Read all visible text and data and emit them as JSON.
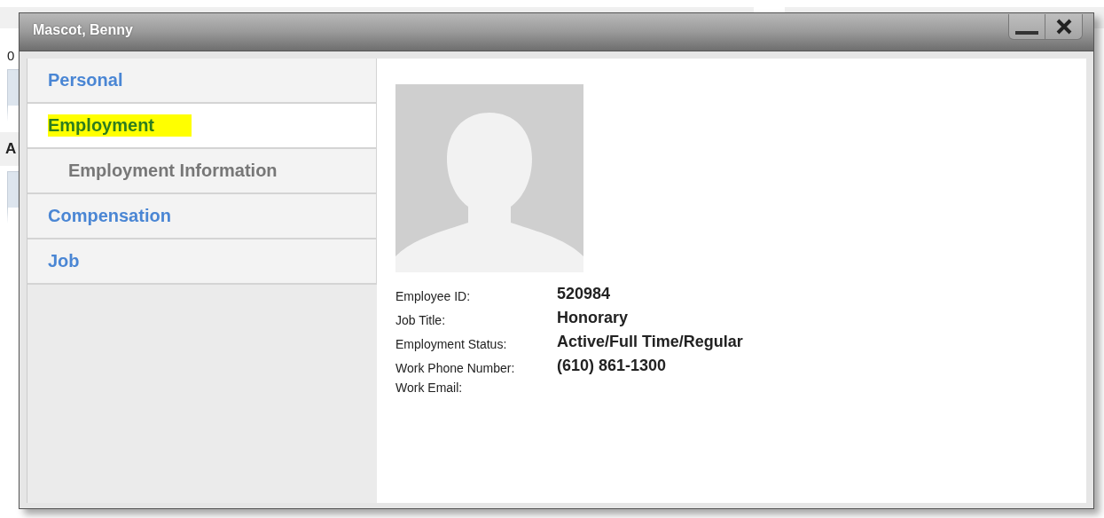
{
  "background": {
    "texts": [
      "0",
      "A"
    ]
  },
  "dialog": {
    "title": "Mascot, Benny",
    "nav": [
      {
        "label": "Personal",
        "kind": "section",
        "selected": false
      },
      {
        "label": "Employment",
        "kind": "section",
        "selected": true
      },
      {
        "label": "Employment Information",
        "kind": "subsection",
        "selected": false
      },
      {
        "label": "Compensation",
        "kind": "section",
        "selected": false
      },
      {
        "label": "Job",
        "kind": "section",
        "selected": false
      }
    ],
    "details": [
      {
        "label": "Employee ID:",
        "value": "520984"
      },
      {
        "label": "Job Title:",
        "value": "Honorary"
      },
      {
        "label": "Employment Status:",
        "value": "Active/Full Time/Regular"
      },
      {
        "label": "Work Phone Number:",
        "value": "(610) 861-1300"
      },
      {
        "label": "Work Email:"
      }
    ]
  }
}
